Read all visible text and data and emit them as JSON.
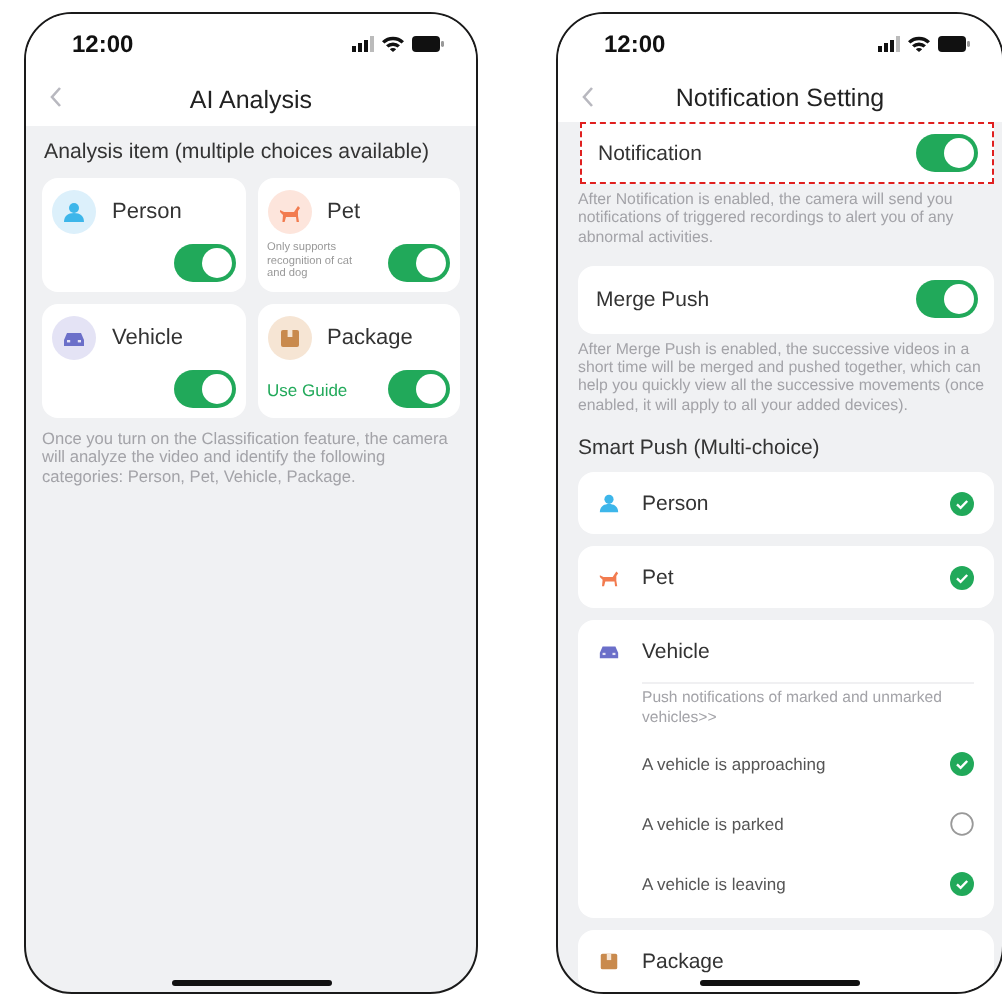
{
  "left_screen": {
    "status_time": "12:00",
    "title": "AI Analysis",
    "section_label": "Analysis item (multiple choices available)",
    "items": [
      {
        "kind": "person",
        "label": "Person",
        "on": true
      },
      {
        "kind": "pet",
        "label": "Pet",
        "note": "Only supports recognition of cat and dog",
        "on": true
      },
      {
        "kind": "vehicle",
        "label": "Vehicle",
        "on": true
      },
      {
        "kind": "package",
        "label": "Package",
        "link": "Use Guide",
        "on": true
      }
    ],
    "footer": "Once you turn on the Classification feature, the camera will analyze the video and identify the following categories: Person, Pet, Vehicle, Package."
  },
  "right_screen": {
    "status_time": "12:00",
    "title": "Notification Setting",
    "notification": {
      "label": "Notification",
      "on": true,
      "highlighted": true
    },
    "notification_note": "After Notification is enabled, the camera will send you notifications of triggered recordings to alert you of any abnormal activities.",
    "merge_push": {
      "label": "Merge Push",
      "on": true
    },
    "merge_push_note": "After Merge Push is enabled, the successive videos in a short time will be merged and pushed together, which can help you quickly view all the successive movements (once enabled, it will apply to all your added devices).",
    "smart_push_label": "Smart Push (Multi-choice)",
    "items": [
      {
        "kind": "person",
        "label": "Person",
        "checked": true
      },
      {
        "kind": "pet",
        "label": "Pet",
        "checked": true
      },
      {
        "kind": "vehicle",
        "label": "Vehicle",
        "note": "Push notifications of marked and unmarked vehicles>>",
        "options": [
          {
            "label": "A vehicle is approaching",
            "checked": true
          },
          {
            "label": "A vehicle is parked",
            "checked": false
          },
          {
            "label": "A vehicle is leaving",
            "checked": true
          }
        ]
      },
      {
        "kind": "package",
        "label": "Package"
      }
    ]
  }
}
